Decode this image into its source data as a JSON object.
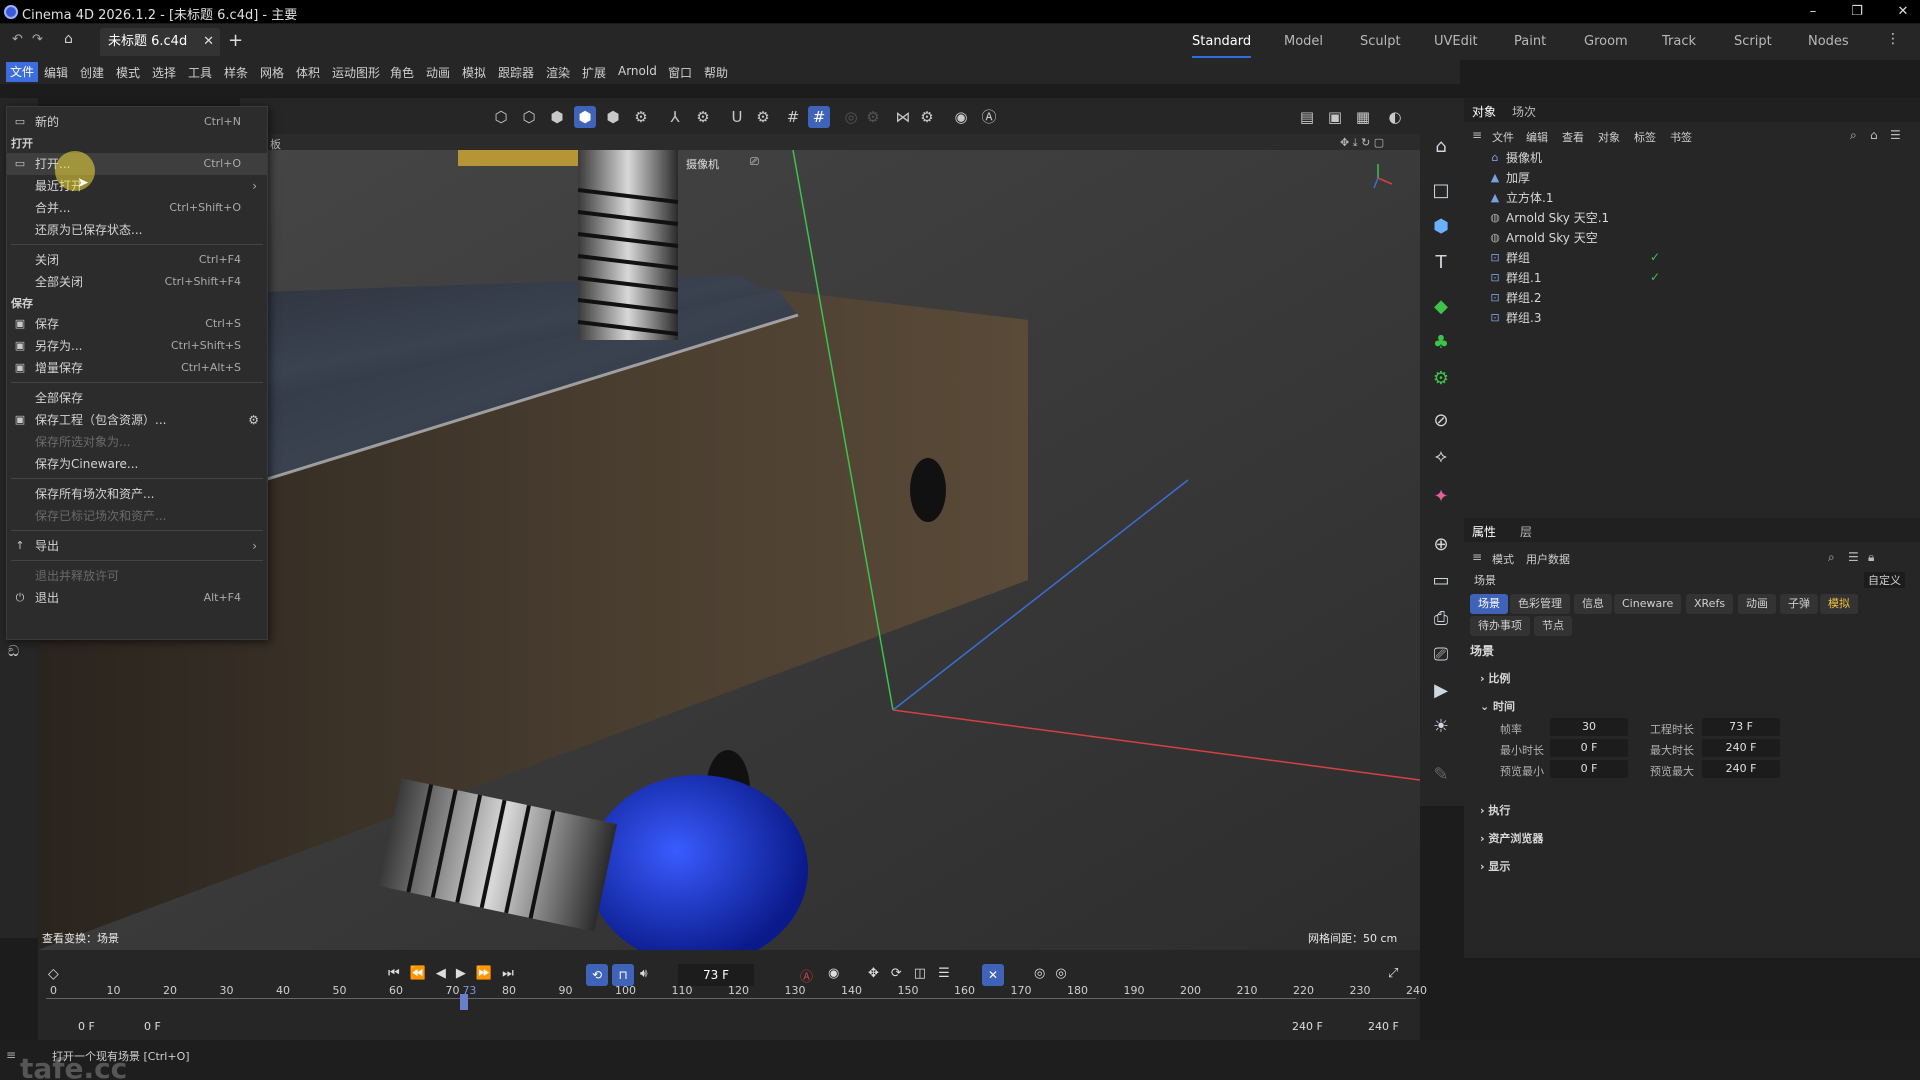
{
  "window": {
    "title": "Cinema 4D 2026.1.2 - [未标题 6.c4d] - 主要"
  },
  "doc_tab": {
    "label": "未标题 6.c4d"
  },
  "layouts": [
    "Standard",
    "Model",
    "Sculpt",
    "UVEdit",
    "Paint",
    "Groom",
    "Track",
    "Script",
    "Nodes"
  ],
  "menu": [
    "文件",
    "编辑",
    "创建",
    "模式",
    "选择",
    "工具",
    "样条",
    "网格",
    "体积",
    "运动图形",
    "角色",
    "动画",
    "模拟",
    "跟踪器",
    "渲染",
    "扩展",
    "Arnold",
    "窗口",
    "帮助"
  ],
  "file_menu": {
    "items": [
      {
        "label": "新的",
        "shortcut": "Ctrl+N",
        "icon": "new-doc-icon"
      },
      {
        "section": "打开"
      },
      {
        "label": "打开...",
        "shortcut": "Ctrl+O",
        "icon": "folder-icon",
        "highlight": true
      },
      {
        "label": "最近打开",
        "shortcut": "",
        "submenu": true
      },
      {
        "label": "合并...",
        "shortcut": "Ctrl+Shift+O"
      },
      {
        "label": "还原为已保存状态..."
      },
      {
        "sep": true
      },
      {
        "label": "关闭",
        "shortcut": "Ctrl+F4"
      },
      {
        "label": "全部关闭",
        "shortcut": "Ctrl+Shift+F4"
      },
      {
        "section": "保存"
      },
      {
        "label": "保存",
        "shortcut": "Ctrl+S",
        "icon": "save-icon"
      },
      {
        "label": "另存为...",
        "shortcut": "Ctrl+Shift+S",
        "icon": "save-as-icon"
      },
      {
        "label": "增量保存",
        "shortcut": "Ctrl+Alt+S",
        "icon": "incremental-save-icon"
      },
      {
        "sep": true
      },
      {
        "label": "全部保存"
      },
      {
        "label": "保存工程（包含资源）...",
        "icon": "project-icon",
        "gear": true
      },
      {
        "label": "保存所选对象为...",
        "dim": true
      },
      {
        "label": "保存为Cineware..."
      },
      {
        "sep": true
      },
      {
        "label": "保存所有场次和资产..."
      },
      {
        "label": "保存已标记场次和资产...",
        "dim": true
      },
      {
        "sep": true
      },
      {
        "label": "导出",
        "icon": "export-icon",
        "submenu": true
      },
      {
        "sep": true
      },
      {
        "label": "退出并释放许可",
        "dim": true
      },
      {
        "label": "退出",
        "shortcut": "Alt+F4",
        "icon": "power-icon"
      }
    ]
  },
  "viewport": {
    "camera_label": "摄像机",
    "view_label": "查看变换：场景",
    "grid_label": "网格间距：50 cm",
    "panel_fragment": "板"
  },
  "object_manager": {
    "tabs": [
      "对象",
      "场次"
    ],
    "menu": [
      "文件",
      "编辑",
      "查看",
      "对象",
      "标签",
      "书签"
    ],
    "objects": [
      "摄像机",
      "加厚",
      "立方体.1",
      "Arnold Sky 天空.1",
      "Arnold Sky 天空",
      "群组",
      "群组.1",
      "群组.2",
      "群组.3"
    ]
  },
  "attributes": {
    "tabs": [
      "属性",
      "层"
    ],
    "menu": [
      "模式",
      "用户数据"
    ],
    "context": "场景",
    "preset": "自定义",
    "buttons": [
      "场景",
      "色彩管理",
      "信息",
      "Cineware",
      "XRefs",
      "动画",
      "子弹",
      "模拟",
      "待办事项",
      "节点"
    ],
    "title": "场景",
    "sections": [
      "比例",
      "时间",
      "执行",
      "资产浏览器",
      "显示"
    ],
    "fields": [
      {
        "label": "帧率",
        "value": "30"
      },
      {
        "label": "工程时长",
        "value": "73 F"
      },
      {
        "label": "最小时长",
        "value": "0 F"
      },
      {
        "label": "最大时长",
        "value": "240 F"
      },
      {
        "label": "预览最小",
        "value": "0 F"
      },
      {
        "label": "预览最大",
        "value": "240 F"
      }
    ]
  },
  "timeline": {
    "current_frame": "73 F",
    "ticks": [
      "0",
      "10",
      "20",
      "30",
      "40",
      "50",
      "60",
      "70",
      "73",
      "80",
      "90",
      "100",
      "110",
      "120",
      "130",
      "140",
      "150",
      "160",
      "170",
      "180",
      "190",
      "200",
      "210",
      "220",
      "230",
      "240"
    ],
    "start_a": "0 F",
    "start_b": "0 F",
    "end_a": "240 F",
    "end_b": "240 F"
  },
  "status": {
    "text": "打开一个现有场景 [Ctrl+O]",
    "watermark": "tafe.cc"
  },
  "colors": {
    "accent": "#3e63b8",
    "highlight": "#3d6ee0"
  }
}
